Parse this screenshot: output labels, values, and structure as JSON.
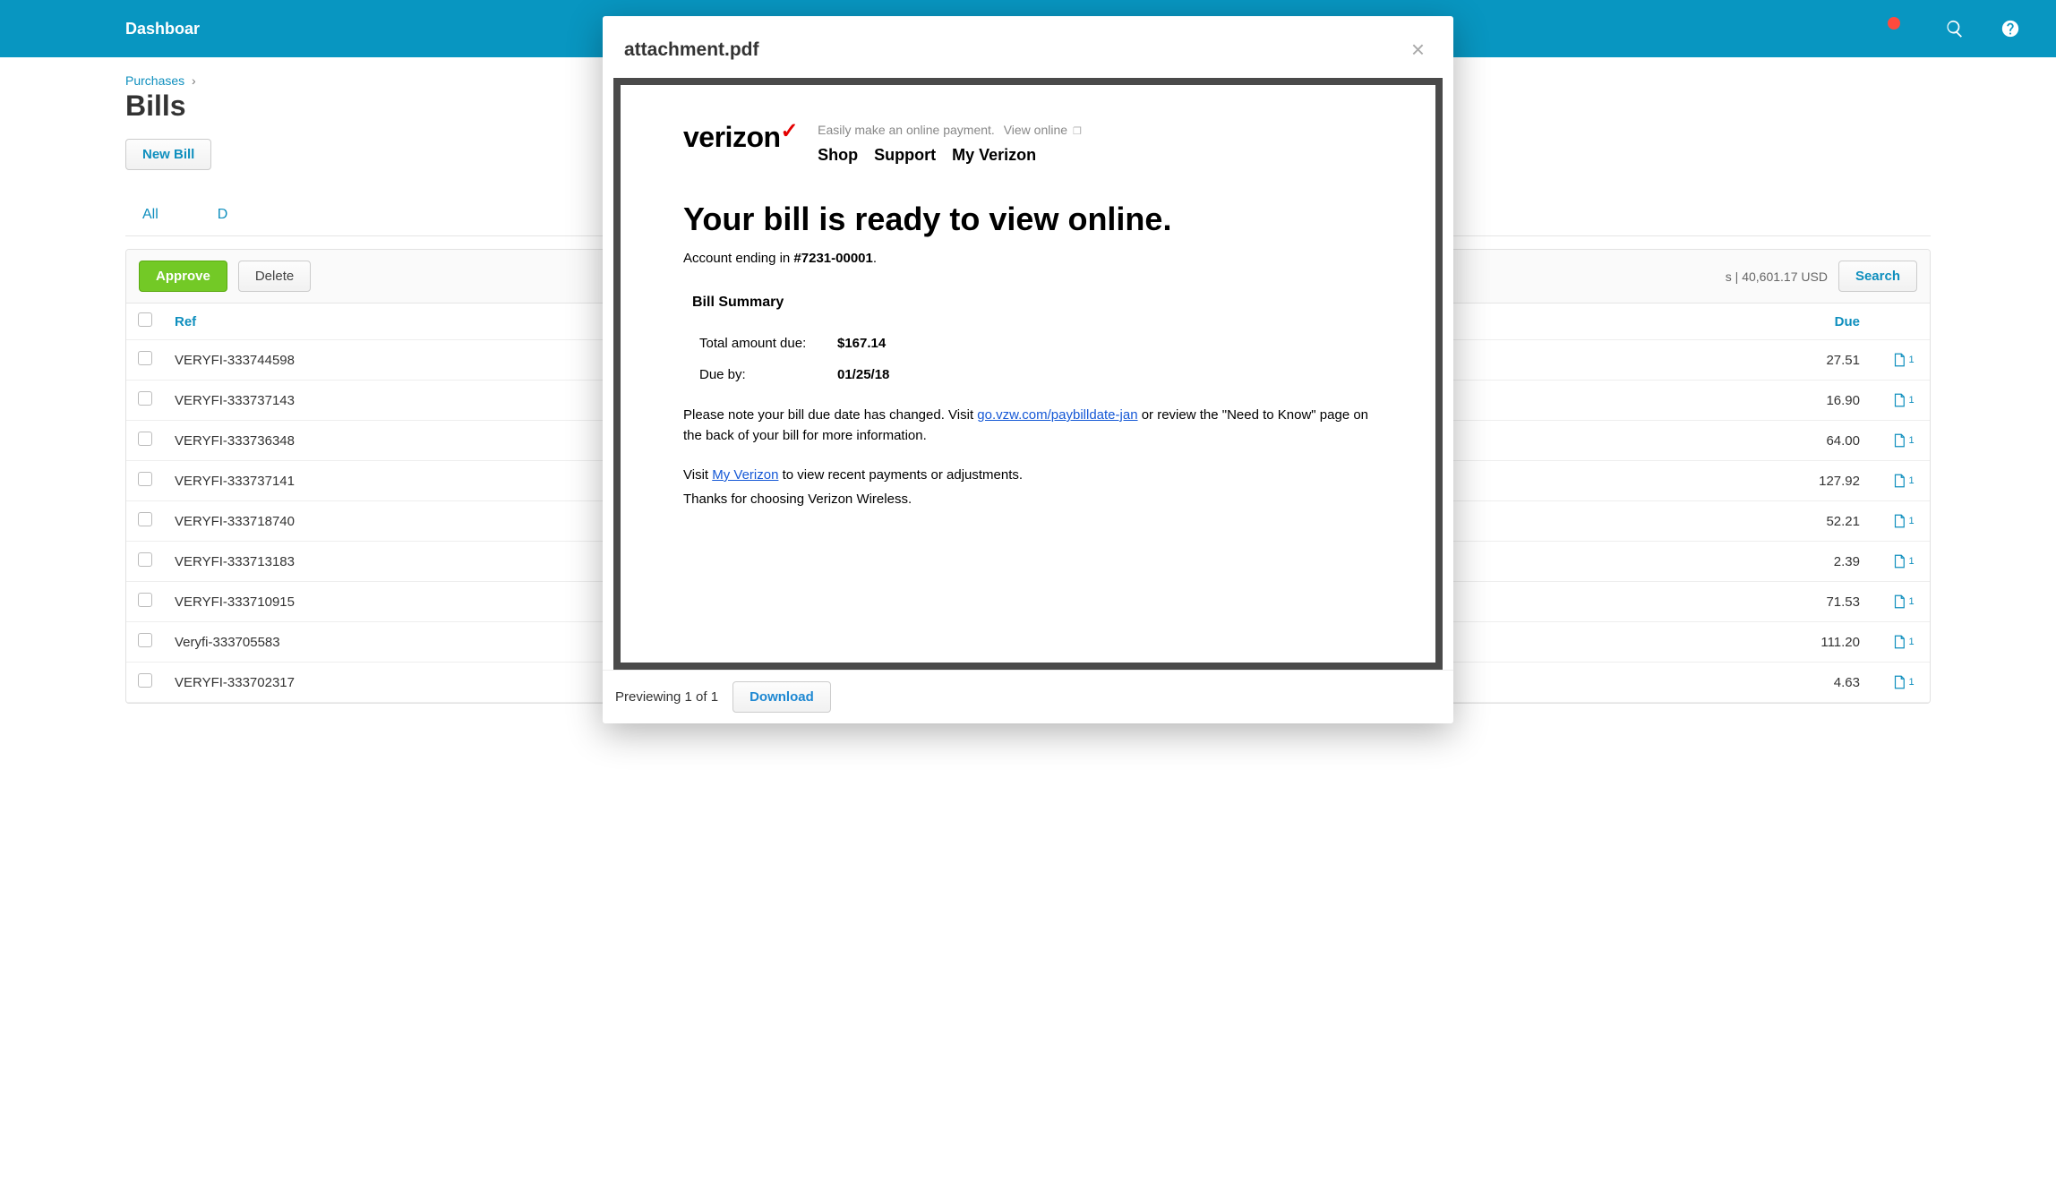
{
  "topbar": {
    "dashboard": "Dashboar"
  },
  "breadcrumb": {
    "parent": "Purchases",
    "sep": "›"
  },
  "page_title": "Bills",
  "buttons": {
    "new_bill": "New Bill",
    "approve": "Approve",
    "delete": "Delete",
    "search": "Search",
    "download": "Download"
  },
  "tabs": {
    "all": "All",
    "second_letter": "D"
  },
  "totals_text": "s | 40,601.17 USD",
  "columns": {
    "ref": "Ref",
    "due": "Due"
  },
  "rows": [
    {
      "ref": "VERYFI-333744598",
      "due": "27.51",
      "att": "1"
    },
    {
      "ref": "VERYFI-333737143",
      "due": "16.90",
      "att": "1"
    },
    {
      "ref": "VERYFI-333736348",
      "due": "64.00",
      "att": "1"
    },
    {
      "ref": "VERYFI-333737141",
      "due": "127.92",
      "att": "1"
    },
    {
      "ref": "VERYFI-333718740",
      "due": "52.21",
      "att": "1"
    },
    {
      "ref": "VERYFI-333713183",
      "due": "2.39",
      "att": "1"
    },
    {
      "ref": "VERYFI-333710915",
      "due": "71.53",
      "att": "1"
    },
    {
      "ref": "Veryfi-333705583",
      "due": "111.20",
      "att": "1"
    },
    {
      "ref": "VERYFI-333702317",
      "due": "4.63",
      "att": "1"
    }
  ],
  "modal": {
    "title": "attachment.pdf",
    "preview_text": "Previewing 1 of 1"
  },
  "pdf": {
    "logo": "verizon",
    "tagline": "Easily make an online payment.",
    "view_online": "View online",
    "nav": {
      "shop": "Shop",
      "support": "Support",
      "my": "My Verizon"
    },
    "headline": "Your bill is ready to view online.",
    "account_prefix": "Account ending in ",
    "account_num": "#7231-00001",
    "account_suffix": ".",
    "summary_h": "Bill Summary",
    "total_label": "Total amount due:",
    "total_value": "$167.14",
    "dueby_label": "Due by:",
    "dueby_value": "01/25/18",
    "note_pre": "Please note your bill due date has changed. Visit ",
    "note_link": "go.vzw.com/paybilldate-jan",
    "note_post": " or review the \"Need to Know\" page on the back of your bill for more information.",
    "visit_pre": "Visit ",
    "visit_link": "My Verizon",
    "visit_post": " to view recent payments or adjustments.",
    "thanks": "Thanks for choosing Verizon Wireless."
  }
}
